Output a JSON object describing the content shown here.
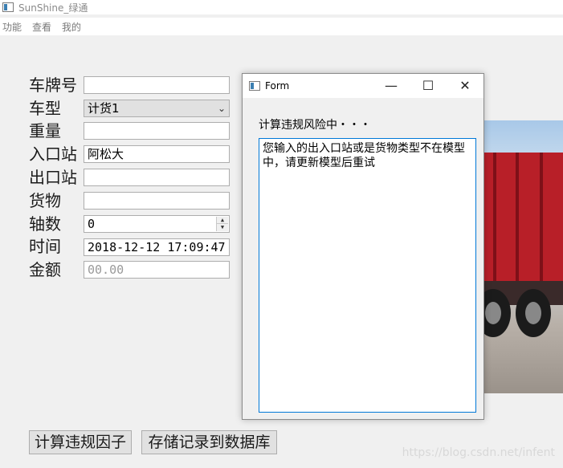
{
  "window": {
    "title": "SunShine_绿通"
  },
  "menu": [
    "功能",
    "查看",
    "我的"
  ],
  "form": {
    "plate_label": "车牌号",
    "plate_value": "",
    "type_label": "车型",
    "type_value": "计货1",
    "weight_label": "重量",
    "weight_value": "",
    "entry_label": "入口站",
    "entry_value": "阿松大",
    "exit_label": "出口站",
    "exit_value": "",
    "cargo_label": "货物",
    "cargo_value": "",
    "axles_label": "轴数",
    "axles_value": "0",
    "time_label": "时间",
    "time_value": "2018-12-12 17:09:47",
    "amount_label": "金额",
    "amount_value": "00.00"
  },
  "buttons": {
    "calc": "计算违规因子",
    "save": "存储记录到数据库"
  },
  "dialog": {
    "title": "Form",
    "status": "计算违规风险中・・・",
    "message": "您输入的出入口站或是货物类型不在模型中，请更新模型后重试"
  },
  "watermark": "https://blog.csdn.net/infent"
}
